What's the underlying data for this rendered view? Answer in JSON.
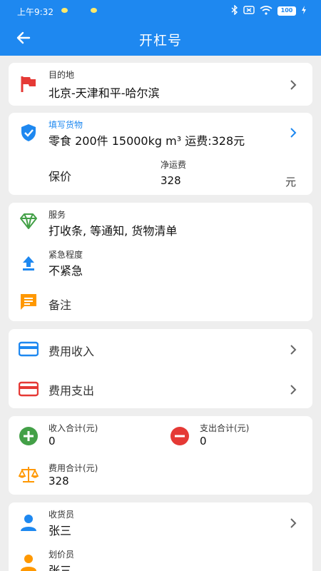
{
  "status": {
    "time": "上午9:32",
    "battery": "100"
  },
  "header": {
    "title": "开杠号"
  },
  "destination": {
    "label": "目的地",
    "value": "北京-天津和平-哈尔滨"
  },
  "cargo": {
    "label": "填写货物",
    "value": "零食 200件 15000kg m³ 运费:328元",
    "insurance_label": "保价",
    "net_fee_label": "净运费",
    "net_fee_value": "328",
    "unit": "元"
  },
  "service": {
    "service_label": "服务",
    "service_value": "打收条, 等通知, 货物清单",
    "urgency_label": "紧急程度",
    "urgency_value": "不紧急",
    "remark_label": "备注"
  },
  "fees": {
    "income_label": "费用收入",
    "expense_label": "费用支出"
  },
  "totals": {
    "income_total_label": "收入合计(元)",
    "income_total_value": "0",
    "expense_total_label": "支出合计(元)",
    "expense_total_value": "0",
    "fee_total_label": "费用合计(元)",
    "fee_total_value": "328"
  },
  "people": {
    "receiver_label": "收货员",
    "receiver_value": "张三",
    "pricer_label": "划价员",
    "pricer_value": "张三"
  },
  "colors": {
    "primary": "#1e88f0",
    "flag_red": "#e53935",
    "green": "#43a047",
    "orange": "#ff9800",
    "red_minus": "#e53935"
  }
}
